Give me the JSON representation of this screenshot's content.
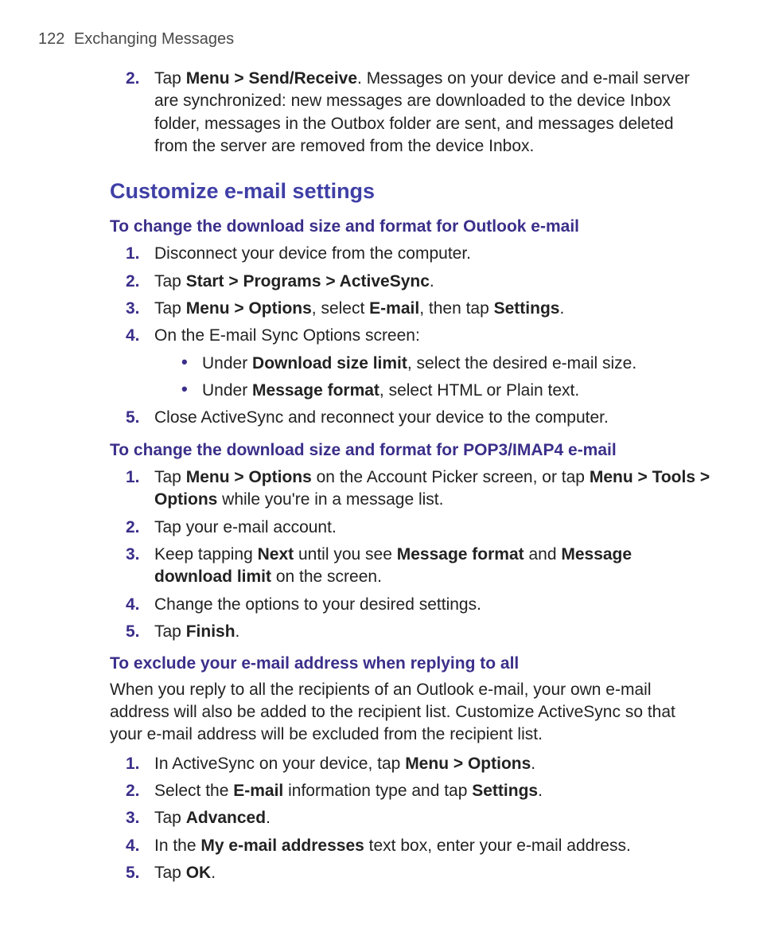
{
  "header": {
    "page_number": "122",
    "chapter": "Exchanging Messages"
  },
  "top_list": {
    "items": [
      {
        "num": "2.",
        "segs": [
          {
            "t": "Tap "
          },
          {
            "t": "Menu > Send/Receive",
            "b": true
          },
          {
            "t": ". Messages on your device and e-mail server are synchronized: new messages are downloaded to the device Inbox folder, messages in the Outbox folder are sent, and messages deleted from the server are removed from the device Inbox."
          }
        ]
      }
    ]
  },
  "section": {
    "title": "Customize e-mail settings"
  },
  "sub1": {
    "title": "To change the download size and format for Outlook e-mail",
    "items": [
      {
        "num": "1.",
        "segs": [
          {
            "t": "Disconnect your device from the computer."
          }
        ]
      },
      {
        "num": "2.",
        "segs": [
          {
            "t": "Tap "
          },
          {
            "t": "Start > Programs > ActiveSync",
            "b": true
          },
          {
            "t": "."
          }
        ]
      },
      {
        "num": "3.",
        "segs": [
          {
            "t": "Tap "
          },
          {
            "t": "Menu > Options",
            "b": true
          },
          {
            "t": ", select "
          },
          {
            "t": "E-mail",
            "b": true
          },
          {
            "t": ", then tap "
          },
          {
            "t": "Settings",
            "b": true
          },
          {
            "t": "."
          }
        ]
      },
      {
        "num": "4.",
        "segs": [
          {
            "t": "On the E-mail Sync Options screen:"
          }
        ],
        "bullets": [
          [
            {
              "t": "Under "
            },
            {
              "t": "Download size limit",
              "b": true
            },
            {
              "t": ", select the desired e-mail size."
            }
          ],
          [
            {
              "t": "Under "
            },
            {
              "t": "Message format",
              "b": true
            },
            {
              "t": ", select HTML or Plain text."
            }
          ]
        ]
      },
      {
        "num": "5.",
        "segs": [
          {
            "t": "Close ActiveSync and reconnect your device to the computer."
          }
        ]
      }
    ]
  },
  "sub2": {
    "title": "To change the download size and format for POP3/IMAP4 e-mail",
    "items": [
      {
        "num": "1.",
        "segs": [
          {
            "t": "Tap "
          },
          {
            "t": "Menu > Options",
            "b": true
          },
          {
            "t": " on the Account Picker screen, or tap "
          },
          {
            "t": "Menu > Tools > Options",
            "b": true
          },
          {
            "t": " while you're in a message list."
          }
        ]
      },
      {
        "num": "2.",
        "segs": [
          {
            "t": "Tap your e-mail account."
          }
        ]
      },
      {
        "num": "3.",
        "segs": [
          {
            "t": "Keep tapping "
          },
          {
            "t": "Next",
            "b": true
          },
          {
            "t": " until you see "
          },
          {
            "t": "Message format",
            "b": true
          },
          {
            "t": " and "
          },
          {
            "t": "Message download limit",
            "b": true
          },
          {
            "t": " on the screen."
          }
        ]
      },
      {
        "num": "4.",
        "segs": [
          {
            "t": "Change the options to your desired settings."
          }
        ]
      },
      {
        "num": "5.",
        "segs": [
          {
            "t": "Tap "
          },
          {
            "t": "Finish",
            "b": true
          },
          {
            "t": "."
          }
        ]
      }
    ]
  },
  "sub3": {
    "title": "To exclude your e-mail address when replying to all",
    "intro": "When you reply to all the recipients of an Outlook e-mail, your own e-mail address will also be added to the recipient list. Customize ActiveSync so that your e-mail address will be excluded from the recipient list.",
    "items": [
      {
        "num": "1.",
        "segs": [
          {
            "t": "In ActiveSync on your device, tap "
          },
          {
            "t": "Menu > Options",
            "b": true
          },
          {
            "t": "."
          }
        ]
      },
      {
        "num": "2.",
        "segs": [
          {
            "t": "Select the "
          },
          {
            "t": "E-mail",
            "b": true
          },
          {
            "t": " information type and tap "
          },
          {
            "t": "Settings",
            "b": true
          },
          {
            "t": "."
          }
        ]
      },
      {
        "num": "3.",
        "segs": [
          {
            "t": "Tap "
          },
          {
            "t": "Advanced",
            "b": true
          },
          {
            "t": "."
          }
        ]
      },
      {
        "num": "4.",
        "segs": [
          {
            "t": "In the "
          },
          {
            "t": "My e-mail addresses",
            "b": true
          },
          {
            "t": " text box, enter your e-mail address."
          }
        ]
      },
      {
        "num": "5.",
        "segs": [
          {
            "t": "Tap "
          },
          {
            "t": "OK",
            "b": true
          },
          {
            "t": "."
          }
        ]
      }
    ]
  }
}
